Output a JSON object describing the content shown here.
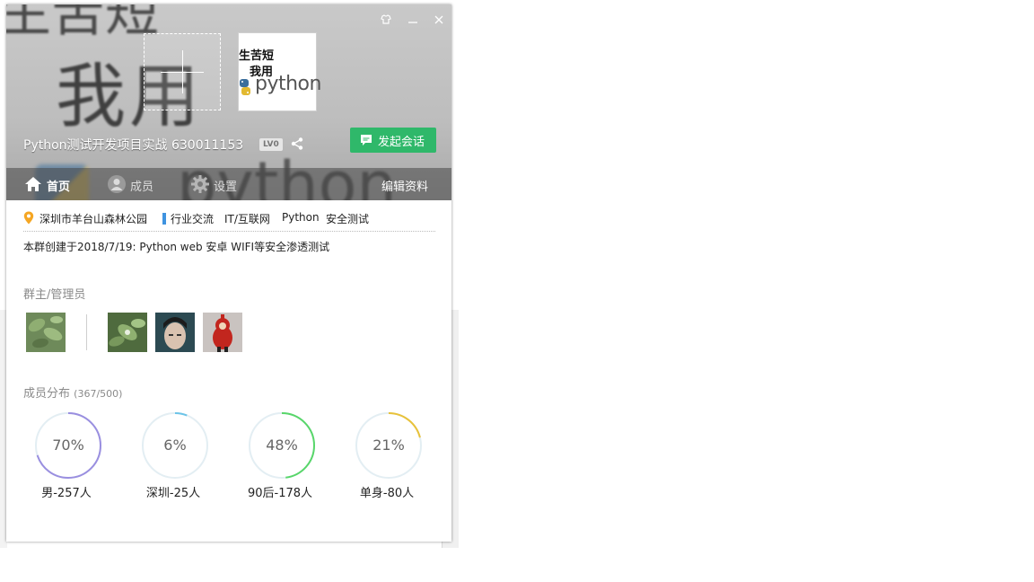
{
  "window": {
    "group_name": "Python测试开发项目实战 630011153",
    "level_badge": "LV0",
    "start_chat_label": "发起会话",
    "avatar_text": {
      "line1": "生苦短",
      "line2": "我用",
      "logo_word": "python"
    }
  },
  "header_background": {
    "big_text": "我用",
    "top_text": "生苦短",
    "python_text": "python"
  },
  "tabs": [
    {
      "label": "首页",
      "icon": "home-icon",
      "active": true
    },
    {
      "label": "成员",
      "icon": "person-icon",
      "active": false
    },
    {
      "label": "设置",
      "icon": "gear-icon",
      "active": false
    }
  ],
  "edit_profile_label": "编辑资料",
  "info": {
    "location": "深圳市羊台山森林公园",
    "tags": [
      "行业交流",
      "IT/互联网",
      "Python",
      "安全测试"
    ],
    "intro": "本群创建于2018/7/19:  Python web 安卓 WIFI等安全渗透测试"
  },
  "admins": {
    "title": "群主/管理员",
    "owner": {
      "avatar": "leaf-photo"
    },
    "members": [
      {
        "avatar": "leaf-photo"
      },
      {
        "avatar": "portrait-photo"
      },
      {
        "avatar": "red-toy-photo"
      }
    ]
  },
  "distribution": {
    "title": "成员分布",
    "count": "(367/500)",
    "stats": [
      {
        "percent_text": "70%",
        "fraction": 0.7,
        "label": "男-257人",
        "color": "#9a8fe0"
      },
      {
        "percent_text": "6%",
        "fraction": 0.06,
        "label": "深圳-25人",
        "color": "#6cc4e8"
      },
      {
        "percent_text": "48%",
        "fraction": 0.48,
        "label": "90后-178人",
        "color": "#58d66a"
      },
      {
        "percent_text": "21%",
        "fraction": 0.21,
        "label": "单身-80人",
        "color": "#e8c23a"
      }
    ]
  },
  "colors": {
    "accent_green": "#2fb86a",
    "tag_bar": "#3f93e0",
    "ring_track": "#e3eef3"
  }
}
